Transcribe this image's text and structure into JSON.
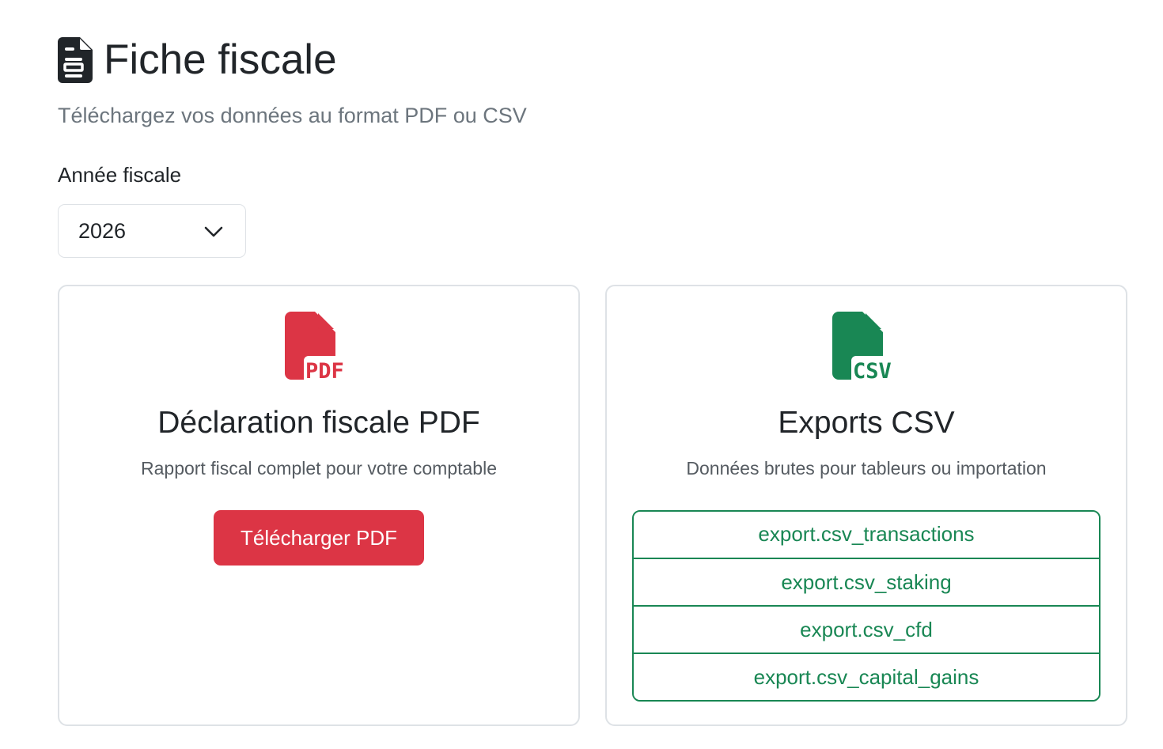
{
  "header": {
    "title": "Fiche fiscale",
    "icon": "file-text-icon",
    "subtitle": "Téléchargez vos données au format PDF ou CSV"
  },
  "year_selector": {
    "label": "Année fiscale",
    "selected": "2026",
    "icon": "chevron-down-icon"
  },
  "pdf_card": {
    "icon": "file-pdf-icon",
    "icon_text": "PDF",
    "title": "Déclaration fiscale PDF",
    "description": "Rapport fiscal complet pour votre comptable",
    "button_label": "Télécharger PDF",
    "accent_color": "#dc3545"
  },
  "csv_card": {
    "icon": "file-csv-icon",
    "icon_text": "CSV",
    "title": "Exports CSV",
    "description": "Données brutes pour tableurs ou importation",
    "accent_color": "#198754",
    "exports": [
      {
        "label": "export.csv_transactions"
      },
      {
        "label": "export.csv_staking"
      },
      {
        "label": "export.csv_cfd"
      },
      {
        "label": "export.csv_capital_gains"
      }
    ]
  }
}
